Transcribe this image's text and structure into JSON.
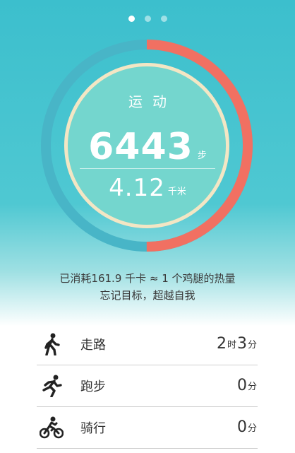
{
  "pager": {
    "count": 3,
    "active": 0
  },
  "activity_card": {
    "title": "运动",
    "steps": "6443",
    "steps_unit": "步",
    "distance": "4.12",
    "distance_unit": "千米",
    "goal_progress": 0.5,
    "colors": {
      "progress": "#f17062",
      "track": "#48b5c7",
      "inner": "#74d6ce",
      "inner_border": "#f3e6c4"
    }
  },
  "summary": {
    "line1": "已消耗161.9 千卡 ≈ 1 个鸡腿的热量",
    "line2": "忘记目标，超越自我"
  },
  "activities": [
    {
      "icon": "walking-icon",
      "label": "走路",
      "h": "2",
      "h_unit": "时",
      "m": "3",
      "m_unit": "分"
    },
    {
      "icon": "running-icon",
      "label": "跑步",
      "m": "0",
      "m_unit": "分"
    },
    {
      "icon": "cycling-icon",
      "label": "骑行",
      "m": "0",
      "m_unit": "分"
    }
  ]
}
